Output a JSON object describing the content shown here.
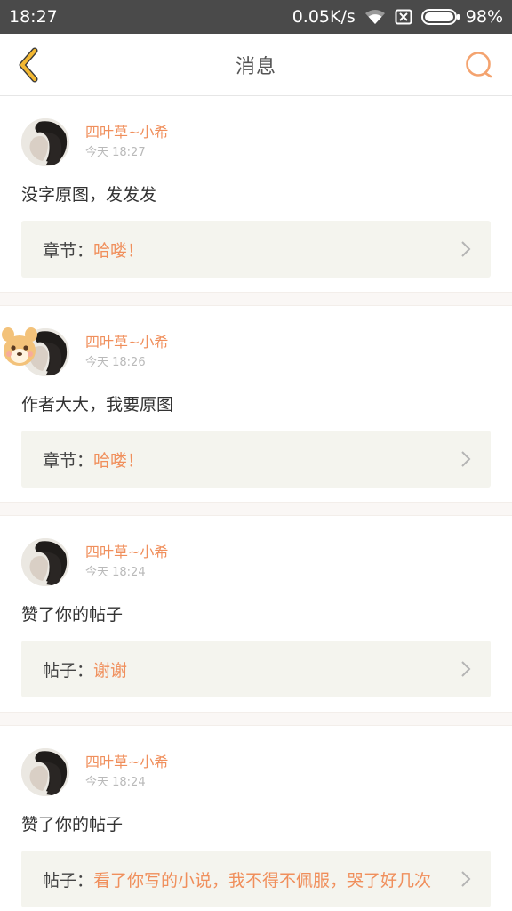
{
  "status_bar": {
    "time": "18:27",
    "network_speed": "0.05K/s",
    "battery": "98%",
    "icons": [
      "wifi-icon",
      "sim-off-icon",
      "battery-icon"
    ]
  },
  "nav": {
    "title": "消息",
    "back_icon": "chevron-left-icon",
    "search_icon": "search-icon"
  },
  "colors": {
    "accent": "#f08f5c",
    "back_arrow": "#f3b832",
    "status_bar_bg": "#4a4a4a",
    "ref_box_bg": "#f4f4ee"
  },
  "messages": [
    {
      "user": "四叶草~小希",
      "time": "今天 18:27",
      "text": "没字原图，发发发",
      "ref_label": "章节：",
      "ref_value": "哈喽！",
      "has_sticker": false
    },
    {
      "user": "四叶草~小希",
      "time": "今天 18:26",
      "text": "作者大大，我要原图",
      "ref_label": "章节：",
      "ref_value": "哈喽！",
      "has_sticker": true
    },
    {
      "user": "四叶草~小希",
      "time": "今天 18:24",
      "text": "赞了你的帖子",
      "ref_label": "帖子：",
      "ref_value": "谢谢",
      "has_sticker": false
    },
    {
      "user": "四叶草~小希",
      "time": "今天 18:24",
      "text": "赞了你的帖子",
      "ref_label": "帖子：",
      "ref_value": "看了你写的小说，我不得不佩服，哭了好几次",
      "has_sticker": false
    }
  ]
}
